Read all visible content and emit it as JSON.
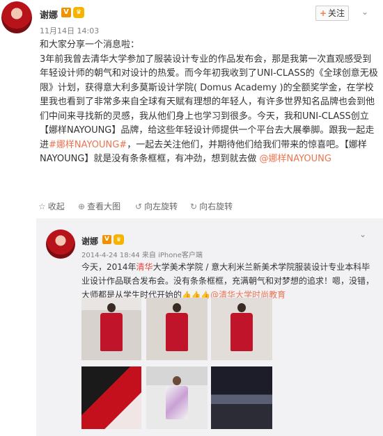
{
  "post": {
    "author": "谢娜",
    "verified_badge": "V",
    "level_badge": "♛",
    "follow_plus": "+",
    "follow_label": "关注",
    "timestamp": "11月14日 14:03",
    "lines": [
      "和大家分享一个消息啦：",
      "3年前我曾去清华大学参加了服装设计专业的作品发布会，那是我第一次直观感受到年轻设计师的朝气和对设计的热爱。而今年初我收到了UNI-CLASS的《全球创意无极限》计划，获得意大利多莫斯设计学院( Domus Academy )的全额奖学金，在学校里我也看到了非常多来自全球有天赋有理想的年轻人，有许多世界知名品牌也会到他们中间来寻找新的灵感，我从他们身上也学习到很多。今天，我和UNI-CLASS创立【娜样NAYOUNG】品牌，给这些年轻设计师提供一个平台去大展拳脚。跟我一起走进"
    ],
    "hashtag": "#娜样NAYOUNG#",
    "after_hashtag": "，一起去关注他们，并期待他们给我们带来的惊喜吧。【娜样NAYOUNG】就是没有条条框框，有冲劲，想到就去做",
    "mention": "@娜样NAYOUNG"
  },
  "actions": [
    {
      "icon": "☆",
      "label": "收起"
    },
    {
      "icon": "⊕",
      "label": "查看大图"
    },
    {
      "icon": "↺",
      "label": "向左旋转"
    },
    {
      "icon": "↻",
      "label": "向右旋转"
    }
  ],
  "repost": {
    "author": "谢娜",
    "verified_badge": "V",
    "level_badge": "♛",
    "meta": "2014-4-24 18:44 来自 iPhone客户端",
    "text_pre": "今天，2014年",
    "text_red": "清华",
    "text_post": "大学美术学院 / 意大利米兰新美术学院服装设计专业本科毕业设计作品联合发布会。没有条条框框，充满朝气和对梦想的追求！嗯，没错，大师都是从学生时代开始的",
    "mention": "@清华大学时尚教育",
    "thumbs": "👍👍👍"
  },
  "icons": {
    "chevron": "chevron-down-icon"
  }
}
